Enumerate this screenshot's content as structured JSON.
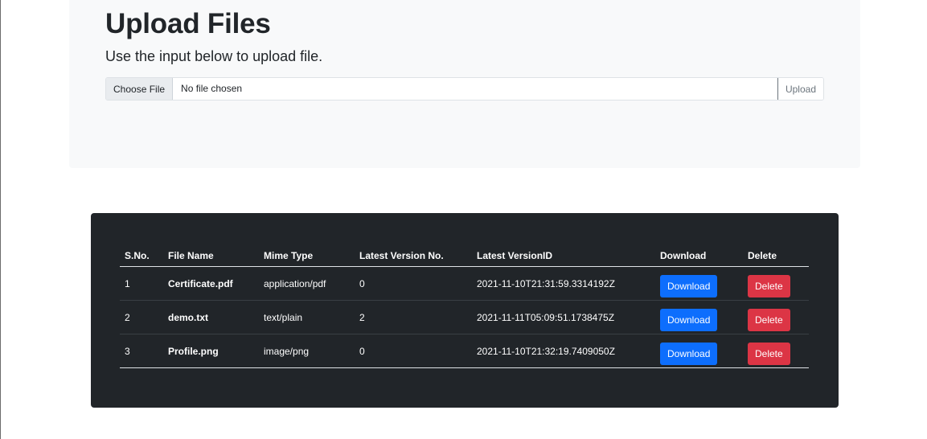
{
  "header": {
    "title": "Upload Files",
    "subtitle": "Use the input below to upload file."
  },
  "upload": {
    "choose_label": "Choose File",
    "file_status": "No file chosen",
    "upload_label": "Upload"
  },
  "table": {
    "headers": [
      "S.No.",
      "File Name",
      "Mime Type",
      "Latest Version No.",
      "Latest VersionID",
      "Download",
      "Delete"
    ],
    "rows": [
      {
        "sno": "1",
        "name": "Certificate.pdf",
        "mime": "application/pdf",
        "version": "0",
        "version_id": "2021-11-10T21:31:59.3314192Z",
        "download_label": "Download",
        "delete_label": "Delete"
      },
      {
        "sno": "2",
        "name": "demo.txt",
        "mime": "text/plain",
        "version": "2",
        "version_id": "2021-11-11T05:09:51.1738475Z",
        "download_label": "Download",
        "delete_label": "Delete"
      },
      {
        "sno": "3",
        "name": "Profile.png",
        "mime": "image/png",
        "version": "0",
        "version_id": "2021-11-10T21:32:19.7409050Z",
        "download_label": "Download",
        "delete_label": "Delete"
      }
    ]
  },
  "colors": {
    "primary": "#0d6efd",
    "danger": "#dc3545",
    "dark": "#212529",
    "light": "#f8f9fa"
  }
}
